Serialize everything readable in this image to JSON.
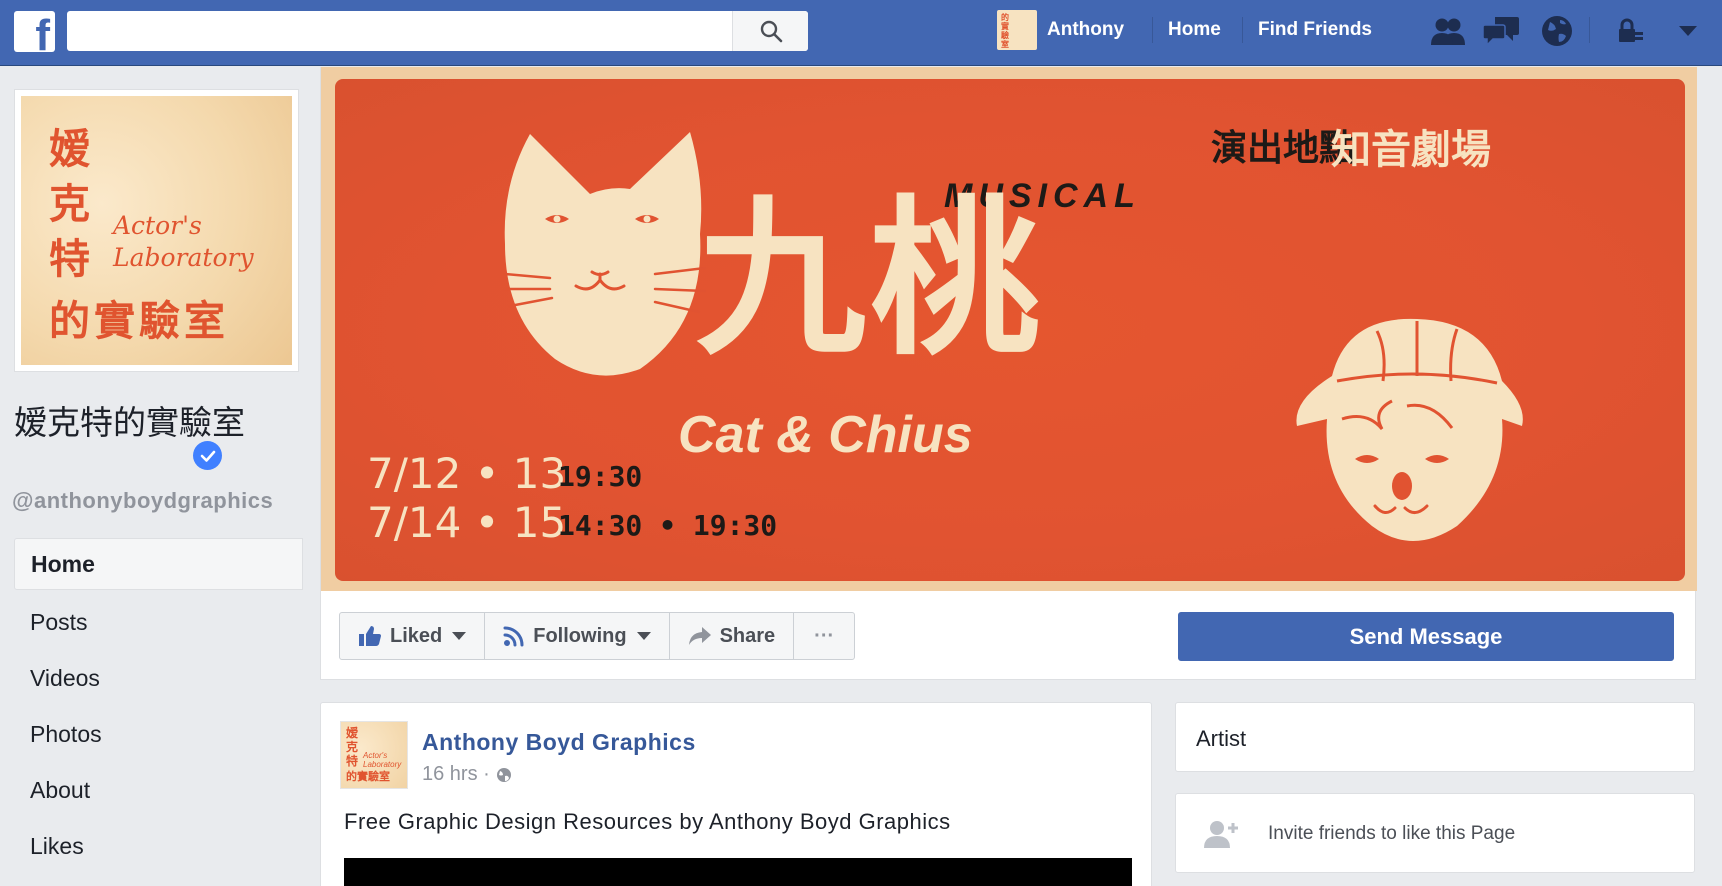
{
  "topbar": {
    "logo": "f",
    "search_placeholder": "",
    "user_name": "Anthony",
    "links": [
      "Home",
      "Find Friends"
    ],
    "icons": [
      "friend-requests-icon",
      "messages-icon",
      "notifications-globe-icon",
      "privacy-lock-icon",
      "account-menu-icon"
    ]
  },
  "page": {
    "name": "嫒克特的實驗室",
    "handle": "@anthonyboydgraphics",
    "verified": true,
    "profile_pic": {
      "cjk_column": [
        "嫒",
        "克",
        "特"
      ],
      "cjk_row": "的實驗室",
      "en_line1": "Actor's",
      "en_line2": "Laboratory"
    }
  },
  "left_nav": [
    {
      "label": "Home",
      "active": true
    },
    {
      "label": "Posts",
      "active": false
    },
    {
      "label": "Videos",
      "active": false
    },
    {
      "label": "Photos",
      "active": false
    },
    {
      "label": "About",
      "active": false
    },
    {
      "label": "Likes",
      "active": false
    }
  ],
  "cover": {
    "venue_label": "演出地點",
    "venue_name": "知音劇場",
    "musical": "MUSICAL",
    "title_cjk": "九桃",
    "title_en": "Cat & Chius",
    "date1": "7/12 • 13",
    "time1": "19:30",
    "date2": "7/14 • 15",
    "time2": "14:30 • 19:30"
  },
  "actions": {
    "liked": "Liked",
    "following": "Following",
    "share": "Share",
    "more": "···",
    "send_message": "Send Message"
  },
  "post": {
    "author": "Anthony Boyd Graphics",
    "time": "16 hrs ·",
    "text": "Free Graphic Design Resources by Anthony Boyd Graphics",
    "avatar": {
      "cjk_column": "嫒克特",
      "cjk_row": "的實驗室",
      "en": "Actor's Laboratory"
    }
  },
  "sidebar": {
    "category": "Artist",
    "invite": "Invite friends to like this Page"
  },
  "colors": {
    "brand_blue": "#4267b2",
    "cover_orange": "#e15331",
    "cream": "#f7e3c1",
    "link_blue": "#365899"
  }
}
